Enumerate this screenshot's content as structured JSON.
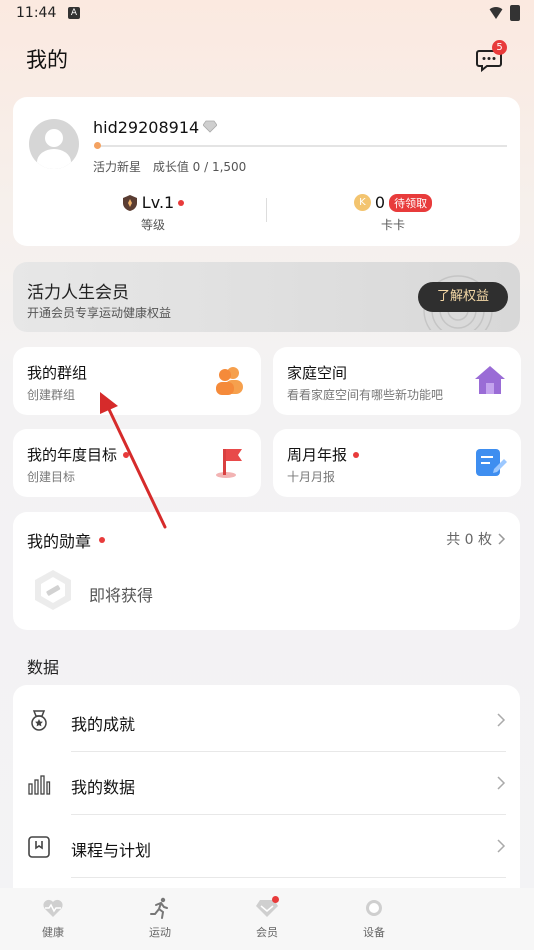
{
  "status": {
    "time": "11:44",
    "notice_glyph": "A"
  },
  "header": {
    "title": "我的",
    "message_badge": "5"
  },
  "profile": {
    "username": "hid29208914",
    "level_name": "活力新星",
    "growth_label": "成长值 0 / 1,500",
    "growth_progress": 0.0,
    "level_value": "Lv.1",
    "level_label": "等级",
    "card_value": "0",
    "card_badge": "待领取",
    "card_label": "卡卡",
    "coin_glyph": "K"
  },
  "vip": {
    "title": "活力人生会员",
    "subtitle": "开通会员专享运动健康权益",
    "button": "了解权益"
  },
  "tiles": [
    {
      "title": "我的群组",
      "subtitle": "创建群组",
      "icon": "group-icon",
      "dot": false
    },
    {
      "title": "家庭空间",
      "subtitle": "看看家庭空间有哪些新功能吧",
      "icon": "home-icon",
      "dot": false
    },
    {
      "title": "我的年度目标",
      "subtitle": "创建目标",
      "icon": "flag-icon",
      "dot": true
    },
    {
      "title": "周月年报",
      "subtitle": "十月月报",
      "icon": "report-icon",
      "dot": true
    }
  ],
  "medals": {
    "title": "我的勋章",
    "count": "共 0 枚",
    "soon": "即将获得"
  },
  "data_section": {
    "label": "数据",
    "items": [
      {
        "label": "我的成就",
        "icon": "medal-icon"
      },
      {
        "label": "我的数据",
        "icon": "bar-chart-icon"
      },
      {
        "label": "课程与计划",
        "icon": "bookmark-icon"
      }
    ]
  },
  "bottom_nav": [
    {
      "label": "健康",
      "icon": "heart-icon"
    },
    {
      "label": "运动",
      "icon": "run-icon"
    },
    {
      "label": "会员",
      "icon": "diamond-icon"
    },
    {
      "label": "设备",
      "icon": "watch-icon"
    }
  ],
  "colors": {
    "accent_red": "#e83b3b",
    "vip_button_bg": "#2f2f2f",
    "vip_button_text": "#f3d7a6",
    "annotation_arrow": "#d62b2b"
  }
}
